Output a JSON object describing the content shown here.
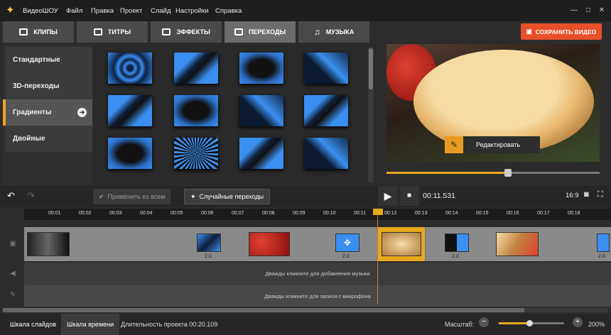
{
  "app": {
    "name": "ВидеоШОУ"
  },
  "menu": [
    "Файл",
    "Правка",
    "Проект",
    "Слайд",
    "Настройки",
    "Справка"
  ],
  "window_buttons": {
    "min": "—",
    "max": "□",
    "close": "✕"
  },
  "tabs": [
    {
      "label": "КЛИПЫ",
      "icon": "film-icon"
    },
    {
      "label": "ТИТРЫ",
      "icon": "text-icon"
    },
    {
      "label": "ЭФФЕКТЫ",
      "icon": "effects-icon"
    },
    {
      "label": "ПЕРЕХОДЫ",
      "icon": "transitions-icon",
      "active": true
    },
    {
      "label": "МУЗЫКА",
      "icon": "music-icon"
    }
  ],
  "save_button": "СОХРАНИТЬ ВИДЕО",
  "categories": [
    "Стандартные",
    "3D-переходы",
    "Градиенты",
    "Двойные"
  ],
  "active_category": "Градиенты",
  "preview": {
    "edit_button": "Редактировать",
    "seek_progress": 0.57
  },
  "toolbar": {
    "apply_all": "Применить ко всем",
    "random": "Случайные переходы"
  },
  "player": {
    "timecode": "00:11.531",
    "ratio": "16:9"
  },
  "ruler": [
    "00:01",
    "00:02",
    "00:03",
    "00:04",
    "00:05",
    "00:06",
    "00:07",
    "00:08",
    "00:09",
    "00:10",
    "00:11",
    "00:12",
    "00:13",
    "00:14",
    "00:15",
    "00:16",
    "00:17",
    "00:18"
  ],
  "transitions": [
    "2.0",
    "2.0",
    "2.0",
    "2.0"
  ],
  "tracks": {
    "music_hint": "Дважды кликните для добавления музыки",
    "mic_hint": "Дважды кликните для записи с микрофона"
  },
  "status": {
    "slides_tab": "Шкала слайдов",
    "timeline_tab": "Шкала времени",
    "duration": "Длительность проекта 00:20.109",
    "zoom_label": "Масштаб:",
    "zoom_value": "200%"
  },
  "colors": {
    "accent": "#e8a820",
    "save": "#e8502a",
    "transition_blue": "#3a8ff0"
  }
}
